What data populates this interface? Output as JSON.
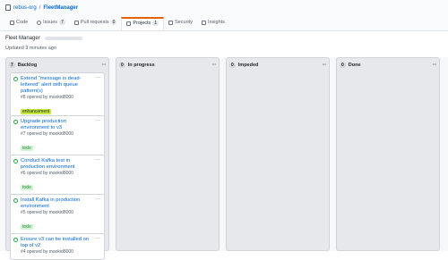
{
  "breadcrumb": {
    "owner": "rebus-org",
    "separator": "/",
    "repo": "FleetManager"
  },
  "tabs": [
    {
      "label": "Code",
      "count": null
    },
    {
      "label": "Issues",
      "count": "7"
    },
    {
      "label": "Pull requests",
      "count": "0"
    },
    {
      "label": "Projects",
      "count": "1"
    },
    {
      "label": "Security",
      "count": null
    },
    {
      "label": "Insights",
      "count": null
    }
  ],
  "project": {
    "title": "Fleet Manager",
    "updated": "Updated 9 minutes ago"
  },
  "columns": [
    {
      "name": "Backlog",
      "count": "7"
    },
    {
      "name": "In progress",
      "count": "0"
    },
    {
      "name": "Impeded",
      "count": "0"
    },
    {
      "name": "Done",
      "count": "0"
    }
  ],
  "cards": [
    {
      "title": "Extend \"message is dead-lettered\" alert with queue pattern(s)",
      "meta": "#8 opened by mookid8000",
      "label": "enhancement",
      "label_color": "#a2eeef"
    },
    {
      "title": "Upgrade production environment to v3",
      "meta": "#7 opened by mookid8000",
      "label": "todo",
      "label_color": "#d4f5d4"
    },
    {
      "title": "Conduct Kafka test in production environment",
      "meta": "#6 opened by mookid8000",
      "label": "todo",
      "label_color": "#d4f5d4"
    },
    {
      "title": "Install Kafka in production environment",
      "meta": "#5 opened by mookid8000",
      "label": "todo",
      "label_color": "#d4f5d4"
    },
    {
      "title": "Ensure v3 can be installed on top of v2",
      "meta": "#4 opened by mookid8000",
      "label": null,
      "label_color": null
    }
  ],
  "colors": {
    "link": "#0366d6",
    "open_issue": "#28a745",
    "active_tab": "#e36209",
    "enhancement_bg": "#c5e83a"
  },
  "icons": {
    "open_issue": "issue-opened-icon",
    "more": "kebab-horizontal-icon"
  }
}
